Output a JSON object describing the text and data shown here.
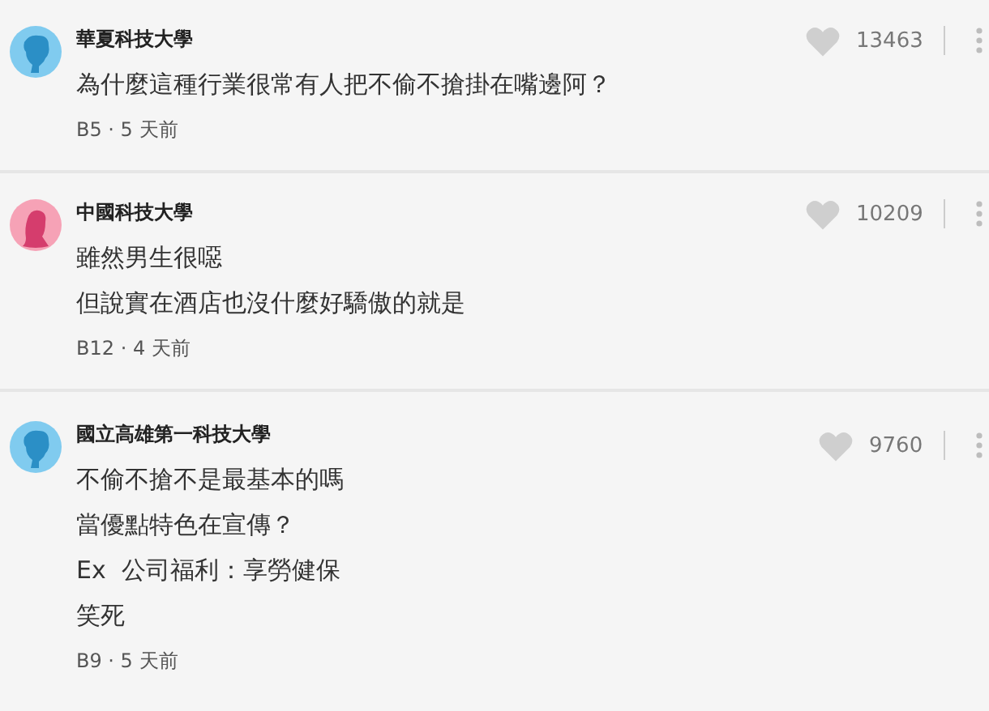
{
  "comments": [
    {
      "author": "華夏科技大學",
      "avatar": {
        "kind": "male"
      },
      "likes": "13463",
      "lines": [
        "為什麼這種行業很常有人把不偷不搶掛在嘴邊阿？"
      ],
      "meta": "B5 · 5 天前"
    },
    {
      "author": "中國科技大學",
      "avatar": {
        "kind": "female"
      },
      "likes": "10209",
      "lines": [
        "雖然男生很噁",
        "但說實在酒店也沒什麼好驕傲的就是"
      ],
      "meta": "B12 · 4 天前"
    },
    {
      "author": "國立高雄第一科技大學",
      "avatar": {
        "kind": "male"
      },
      "likes": "9760",
      "lines": [
        "不偷不搶不是最基本的嗎",
        "當優點特色在宣傳？",
        "Ex  公司福利：享勞健保",
        "笑死"
      ],
      "meta": "B9 · 5 天前"
    }
  ]
}
